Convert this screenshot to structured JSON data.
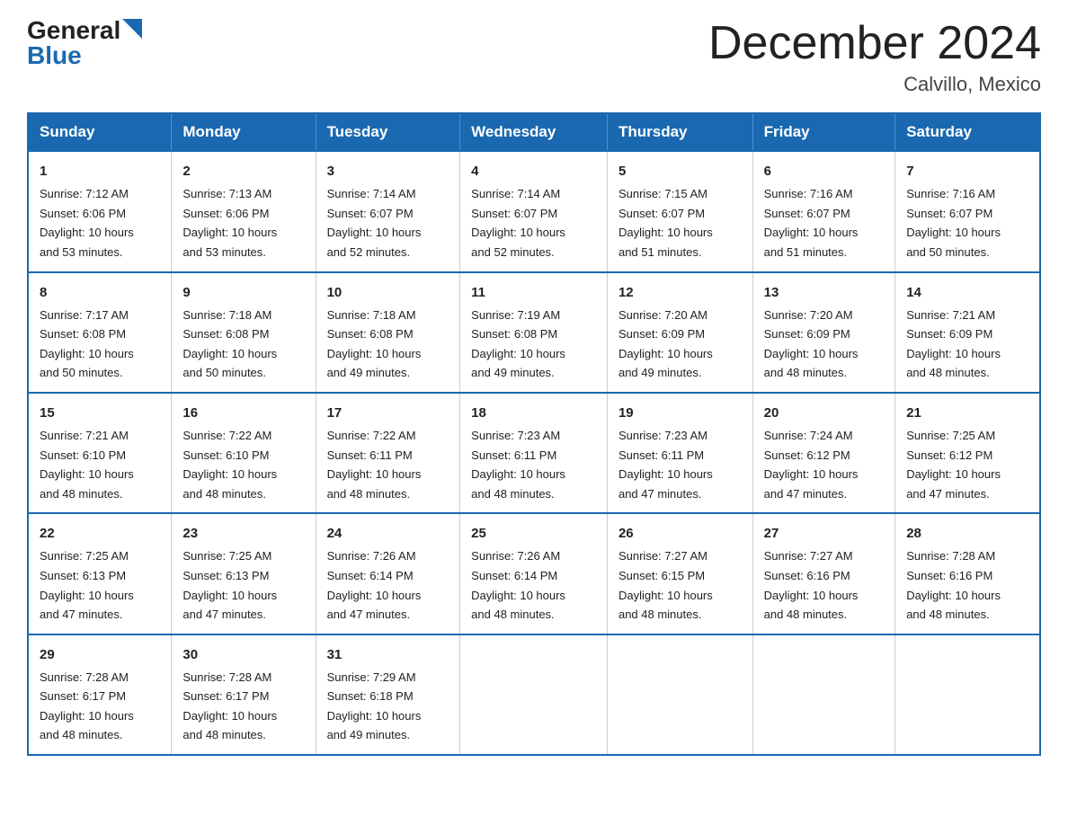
{
  "header": {
    "logo_general": "General",
    "logo_blue": "Blue",
    "month_title": "December 2024",
    "location": "Calvillo, Mexico"
  },
  "days_of_week": [
    "Sunday",
    "Monday",
    "Tuesday",
    "Wednesday",
    "Thursday",
    "Friday",
    "Saturday"
  ],
  "weeks": [
    [
      {
        "num": "1",
        "sunrise": "7:12 AM",
        "sunset": "6:06 PM",
        "daylight": "10 hours and 53 minutes."
      },
      {
        "num": "2",
        "sunrise": "7:13 AM",
        "sunset": "6:06 PM",
        "daylight": "10 hours and 53 minutes."
      },
      {
        "num": "3",
        "sunrise": "7:14 AM",
        "sunset": "6:07 PM",
        "daylight": "10 hours and 52 minutes."
      },
      {
        "num": "4",
        "sunrise": "7:14 AM",
        "sunset": "6:07 PM",
        "daylight": "10 hours and 52 minutes."
      },
      {
        "num": "5",
        "sunrise": "7:15 AM",
        "sunset": "6:07 PM",
        "daylight": "10 hours and 51 minutes."
      },
      {
        "num": "6",
        "sunrise": "7:16 AM",
        "sunset": "6:07 PM",
        "daylight": "10 hours and 51 minutes."
      },
      {
        "num": "7",
        "sunrise": "7:16 AM",
        "sunset": "6:07 PM",
        "daylight": "10 hours and 50 minutes."
      }
    ],
    [
      {
        "num": "8",
        "sunrise": "7:17 AM",
        "sunset": "6:08 PM",
        "daylight": "10 hours and 50 minutes."
      },
      {
        "num": "9",
        "sunrise": "7:18 AM",
        "sunset": "6:08 PM",
        "daylight": "10 hours and 50 minutes."
      },
      {
        "num": "10",
        "sunrise": "7:18 AM",
        "sunset": "6:08 PM",
        "daylight": "10 hours and 49 minutes."
      },
      {
        "num": "11",
        "sunrise": "7:19 AM",
        "sunset": "6:08 PM",
        "daylight": "10 hours and 49 minutes."
      },
      {
        "num": "12",
        "sunrise": "7:20 AM",
        "sunset": "6:09 PM",
        "daylight": "10 hours and 49 minutes."
      },
      {
        "num": "13",
        "sunrise": "7:20 AM",
        "sunset": "6:09 PM",
        "daylight": "10 hours and 48 minutes."
      },
      {
        "num": "14",
        "sunrise": "7:21 AM",
        "sunset": "6:09 PM",
        "daylight": "10 hours and 48 minutes."
      }
    ],
    [
      {
        "num": "15",
        "sunrise": "7:21 AM",
        "sunset": "6:10 PM",
        "daylight": "10 hours and 48 minutes."
      },
      {
        "num": "16",
        "sunrise": "7:22 AM",
        "sunset": "6:10 PM",
        "daylight": "10 hours and 48 minutes."
      },
      {
        "num": "17",
        "sunrise": "7:22 AM",
        "sunset": "6:11 PM",
        "daylight": "10 hours and 48 minutes."
      },
      {
        "num": "18",
        "sunrise": "7:23 AM",
        "sunset": "6:11 PM",
        "daylight": "10 hours and 48 minutes."
      },
      {
        "num": "19",
        "sunrise": "7:23 AM",
        "sunset": "6:11 PM",
        "daylight": "10 hours and 47 minutes."
      },
      {
        "num": "20",
        "sunrise": "7:24 AM",
        "sunset": "6:12 PM",
        "daylight": "10 hours and 47 minutes."
      },
      {
        "num": "21",
        "sunrise": "7:25 AM",
        "sunset": "6:12 PM",
        "daylight": "10 hours and 47 minutes."
      }
    ],
    [
      {
        "num": "22",
        "sunrise": "7:25 AM",
        "sunset": "6:13 PM",
        "daylight": "10 hours and 47 minutes."
      },
      {
        "num": "23",
        "sunrise": "7:25 AM",
        "sunset": "6:13 PM",
        "daylight": "10 hours and 47 minutes."
      },
      {
        "num": "24",
        "sunrise": "7:26 AM",
        "sunset": "6:14 PM",
        "daylight": "10 hours and 47 minutes."
      },
      {
        "num": "25",
        "sunrise": "7:26 AM",
        "sunset": "6:14 PM",
        "daylight": "10 hours and 48 minutes."
      },
      {
        "num": "26",
        "sunrise": "7:27 AM",
        "sunset": "6:15 PM",
        "daylight": "10 hours and 48 minutes."
      },
      {
        "num": "27",
        "sunrise": "7:27 AM",
        "sunset": "6:16 PM",
        "daylight": "10 hours and 48 minutes."
      },
      {
        "num": "28",
        "sunrise": "7:28 AM",
        "sunset": "6:16 PM",
        "daylight": "10 hours and 48 minutes."
      }
    ],
    [
      {
        "num": "29",
        "sunrise": "7:28 AM",
        "sunset": "6:17 PM",
        "daylight": "10 hours and 48 minutes."
      },
      {
        "num": "30",
        "sunrise": "7:28 AM",
        "sunset": "6:17 PM",
        "daylight": "10 hours and 48 minutes."
      },
      {
        "num": "31",
        "sunrise": "7:29 AM",
        "sunset": "6:18 PM",
        "daylight": "10 hours and 49 minutes."
      },
      null,
      null,
      null,
      null
    ]
  ],
  "labels": {
    "sunrise": "Sunrise:",
    "sunset": "Sunset:",
    "daylight": "Daylight:"
  }
}
